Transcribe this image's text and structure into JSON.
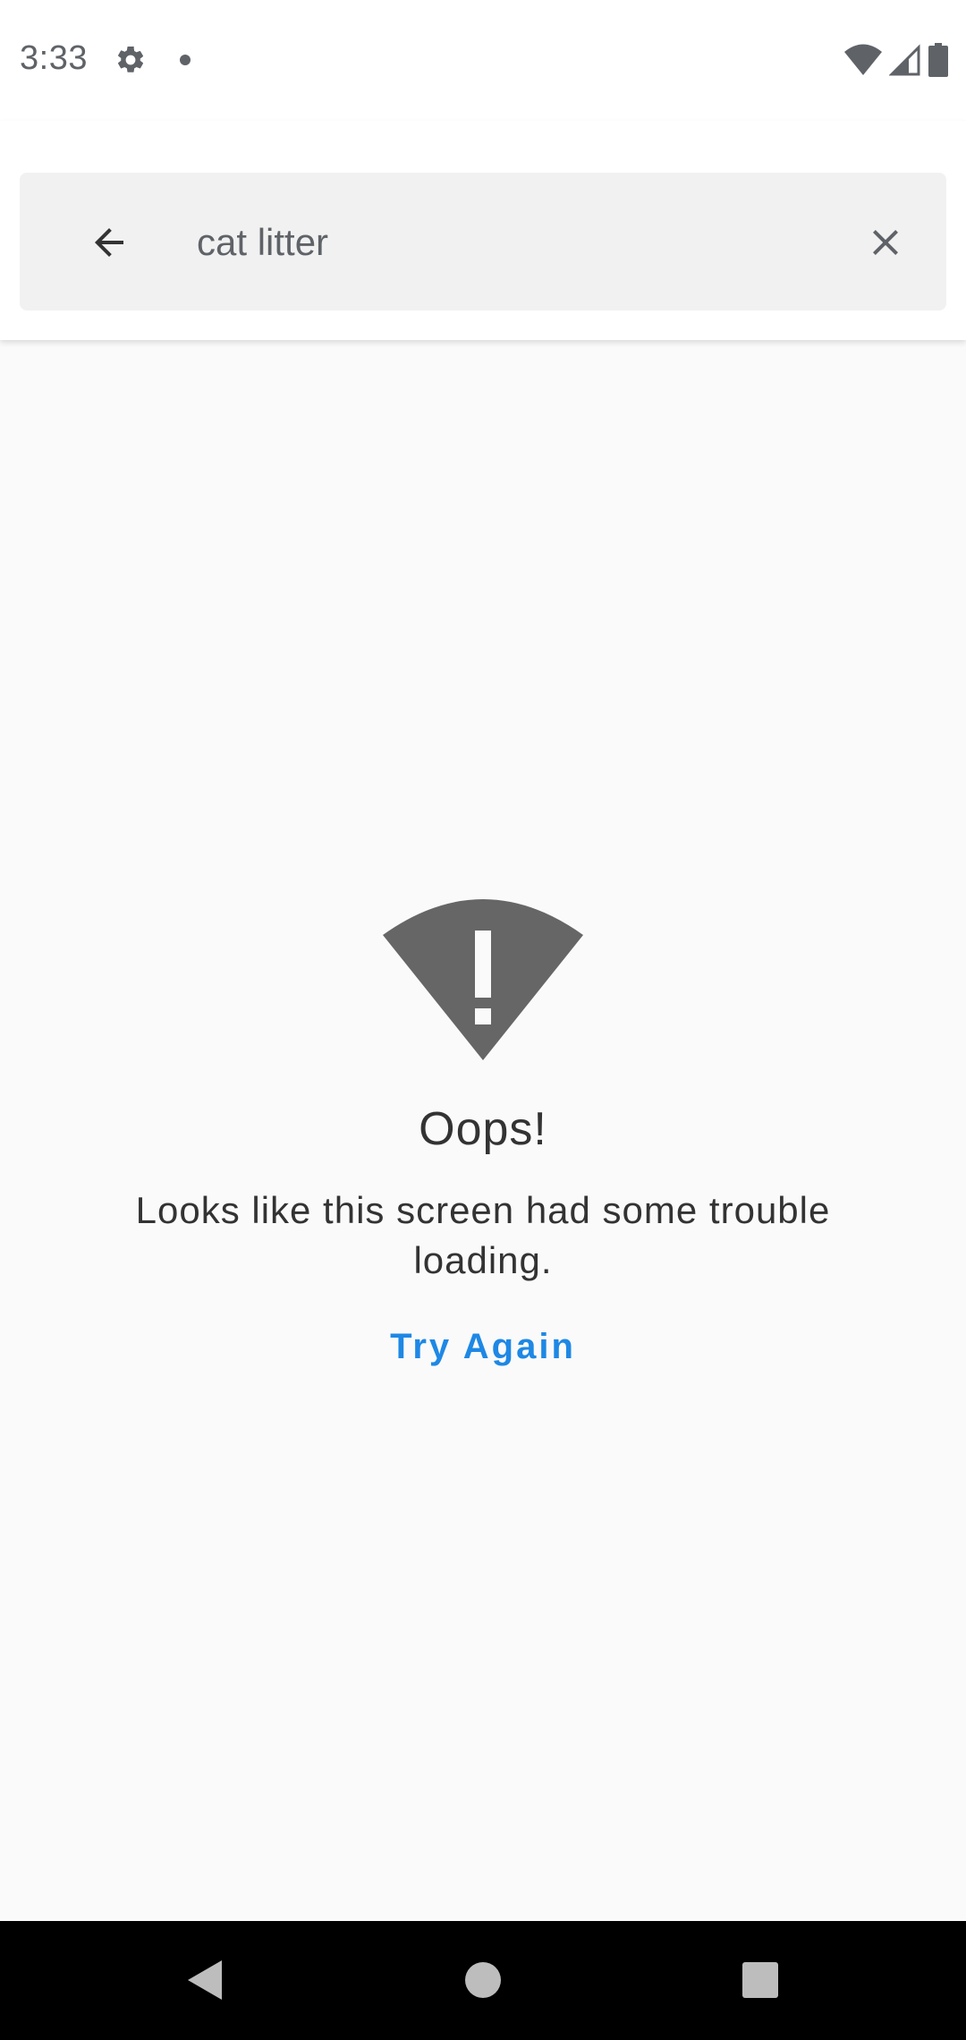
{
  "status_bar": {
    "time": "3:33",
    "icons": [
      "gear-icon",
      "notification-dot-icon",
      "wifi-icon",
      "cell-signal-icon",
      "battery-icon"
    ],
    "icon_color": "#5f6368"
  },
  "search": {
    "query": "cat litter",
    "back_icon": "arrow-left-icon",
    "clear_icon": "close-icon"
  },
  "error": {
    "icon": "no-connection-warning-icon",
    "icon_color": "#666666",
    "title": "Oops!",
    "message": "Looks like this screen had some trouble loading.",
    "retry_label": "Try Again",
    "retry_color": "#1e88e5"
  },
  "nav_bar": {
    "buttons": [
      "back-triangle-icon",
      "home-circle-icon",
      "recents-square-icon"
    ],
    "background": "#000000"
  }
}
